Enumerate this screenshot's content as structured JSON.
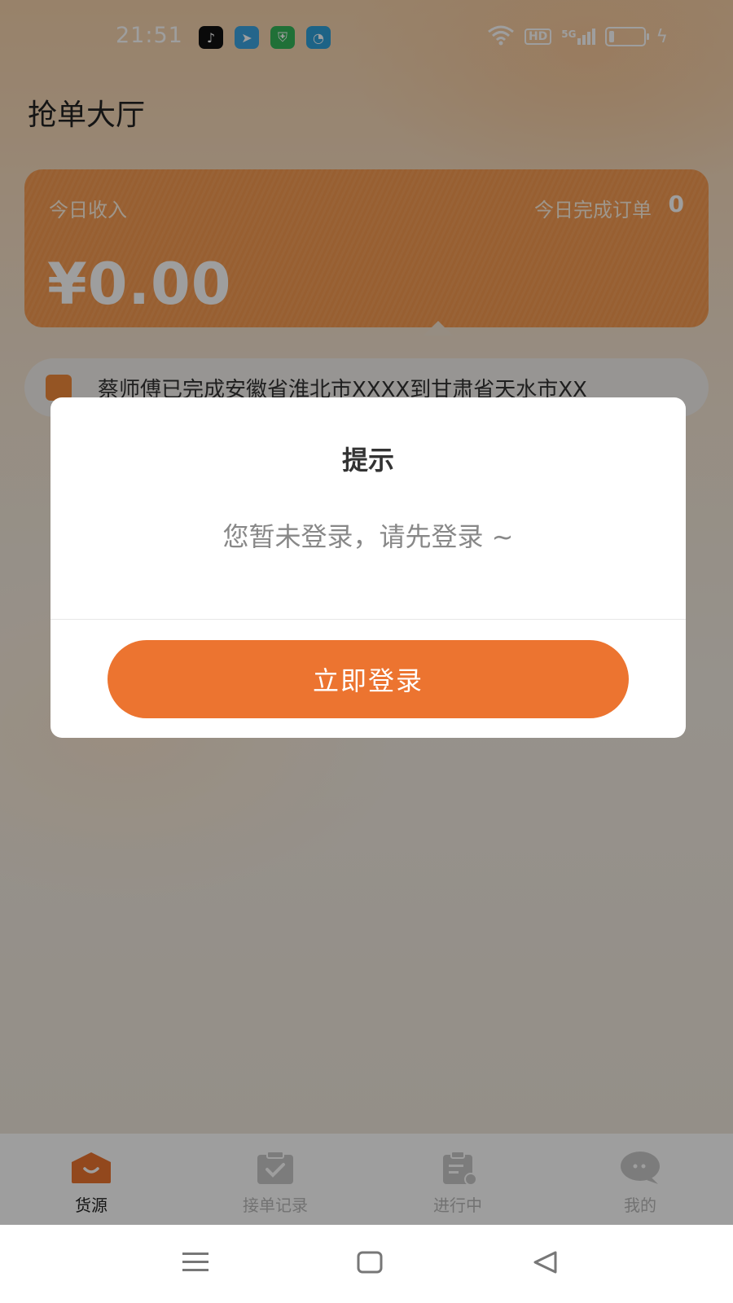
{
  "status_bar": {
    "time": "21:51",
    "network_label": "5G",
    "hd_label": "HD"
  },
  "page": {
    "title": "抢单大厅"
  },
  "income_card": {
    "income_label": "今日收入",
    "income_amount": "¥0.00",
    "orders_label": "今日完成订单",
    "orders_count": "0"
  },
  "ticker": {
    "text": "蔡师傅已完成安徽省淮北市XXXX到甘肃省天水市XX"
  },
  "modal": {
    "title": "提示",
    "message": "您暂未登录，请先登录 ~",
    "login_button_label": "立即登录"
  },
  "bottom_nav": {
    "items": [
      {
        "label": "货源",
        "icon": "box-icon",
        "active": true
      },
      {
        "label": "接单记录",
        "icon": "clipboard-check-icon",
        "active": false
      },
      {
        "label": "进行中",
        "icon": "clipboard-progress-icon",
        "active": false
      },
      {
        "label": "我的",
        "icon": "chat-bubble-icon",
        "active": false
      }
    ]
  },
  "colors": {
    "accent": "#ec7430",
    "card": "#f5a059",
    "nav_inactive": "#b9b9b9"
  }
}
